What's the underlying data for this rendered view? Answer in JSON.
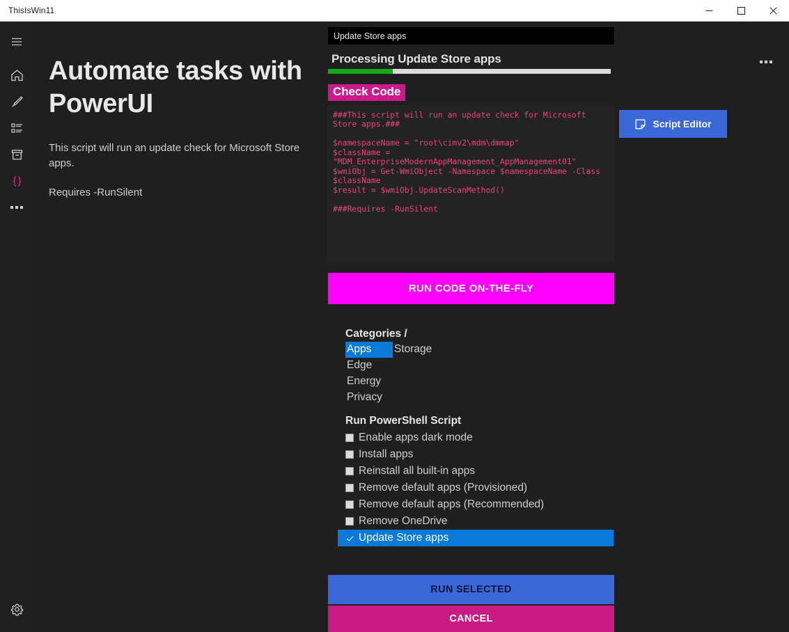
{
  "window": {
    "title": "ThisIsWin11",
    "controls": [
      {
        "name": "minimize",
        "glyph": "minimize-icon"
      },
      {
        "name": "maximize",
        "glyph": "maximize-icon"
      },
      {
        "name": "close",
        "glyph": "close-icon"
      }
    ]
  },
  "sidebar": {
    "items": [
      {
        "icon": "hamburger-menu-icon",
        "label": "Menu",
        "active": false
      },
      {
        "icon": "home-icon",
        "label": "Home",
        "active": false
      },
      {
        "icon": "brush-icon",
        "label": "Personalize",
        "active": false
      },
      {
        "icon": "list-icon",
        "label": "Tasks",
        "active": false
      },
      {
        "icon": "box-icon",
        "label": "Packages",
        "active": false
      },
      {
        "icon": "curly-braces-icon",
        "label": "Automate",
        "active": true
      },
      {
        "icon": "more-dots-icon",
        "label": "More",
        "active": false
      }
    ],
    "settings": {
      "icon": "gear-icon",
      "label": "Settings"
    }
  },
  "left": {
    "title": "Automate tasks with PowerUI",
    "description": "This script will run an update check for Microsoft Store apps.",
    "requires": "Requires -RunSilent"
  },
  "center": {
    "task_header": "Update Store apps",
    "processing_label": "Processing Update Store apps",
    "progress_percent": 23,
    "check_code_label": "Check Code",
    "code": "###This script will run an update check for Microsoft Store apps.###\n\n$namespaceName = \"root\\cimv2\\mdm\\dmmap\"\n$className = \"MDM_EnterpriseModernAppManagement_AppManagement01\"\n$wmiObj = Get-WmiObject -Namespace $namespaceName -Class $className\n$result = $wmiObj.UpdateScanMethod()\n\n###Requires -RunSilent",
    "run_onthefly_label": "RUN CODE ON-THE-FLY"
  },
  "categories": {
    "title": "Categories /",
    "items": [
      {
        "label": "Apps",
        "selected": true
      },
      {
        "label": "Storage",
        "selected": false
      },
      {
        "label": "Edge",
        "selected": false
      },
      {
        "label": "Energy",
        "selected": false
      },
      {
        "label": "Privacy",
        "selected": false
      }
    ]
  },
  "powershell": {
    "title": "Run PowerShell Script",
    "items": [
      {
        "label": "Enable apps dark mode",
        "checked": false,
        "selected": false
      },
      {
        "label": "Install apps",
        "checked": false,
        "selected": false
      },
      {
        "label": "Reinstall all built-in apps",
        "checked": false,
        "selected": false
      },
      {
        "label": "Remove default apps (Provisioned)",
        "checked": false,
        "selected": false
      },
      {
        "label": "Remove default apps (Recommended)",
        "checked": false,
        "selected": false
      },
      {
        "label": "Remove OneDrive",
        "checked": false,
        "selected": false
      },
      {
        "label": "Update Store apps",
        "checked": true,
        "selected": true
      }
    ]
  },
  "actions": {
    "run_selected_label": "RUN SELECTED",
    "cancel_label": "CANCEL"
  },
  "right": {
    "more_menu": "…",
    "script_editor_label": "Script Editor",
    "script_editor_icon": "note-icon"
  },
  "colors": {
    "accent_magenta": "#ff00ff",
    "accent_pink": "#cc1a8c",
    "accent_blue": "#3a68d8",
    "selection_blue": "#0a79d8",
    "progress_green": "#16a916",
    "code_text": "#e8437f",
    "background": "#1f1f1f"
  }
}
